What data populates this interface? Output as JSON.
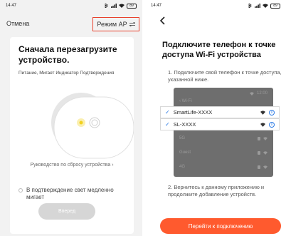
{
  "left": {
    "status_time": "14:47",
    "battery": "89",
    "cancel_label": "Отмена",
    "ap_mode_label": "Режим AP",
    "title": "Сначала перезагрузите устройство.",
    "subtitle": "Питание, Мигает Индикатор Подтверждения",
    "reset_link": "Руководство по сбросу устройства",
    "confirm_text": "В подтверждение свет медленно мигает",
    "next_button": "Вперед",
    "colors": {
      "accent_border": "#e8402c",
      "indicator_light": "#f2d11e"
    }
  },
  "right": {
    "status_time": "14:47",
    "battery": "89",
    "title": "Подключите телефон к точке доступа Wi-Fi устройства",
    "step1": "1. Подключите свой телефон к точке доступа, указанной ниже.",
    "wifi_header": "Wi-Fi",
    "phone_time": "12:00",
    "networks": [
      {
        "name": "SmartLife-XXXX",
        "highlighted": true
      },
      {
        "name": "SL-XXXX",
        "highlighted": true
      },
      {
        "name": "5G",
        "highlighted": false
      },
      {
        "name": "Guest",
        "highlighted": false
      },
      {
        "name": "4G",
        "highlighted": false
      }
    ],
    "step2": "2. Вернитесь к данному приложению и продолжите добавление устройств.",
    "connect_button": "Перейти к подключению",
    "colors": {
      "accent": "#ff5a2e",
      "link": "#2d7be5"
    }
  }
}
